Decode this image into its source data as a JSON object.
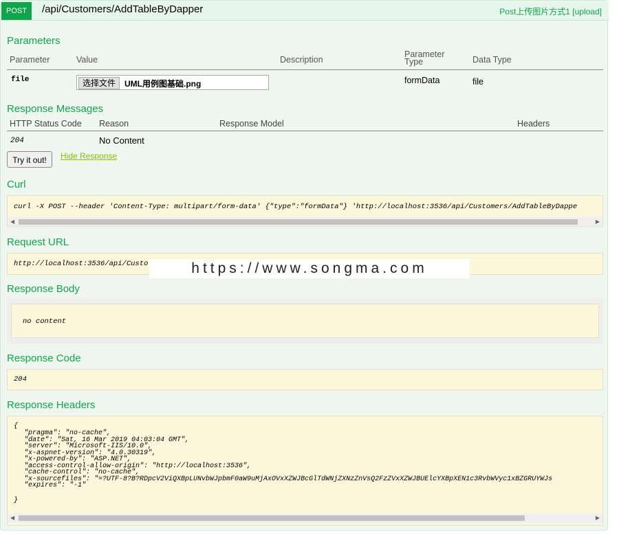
{
  "header": {
    "method": "POST",
    "path": "/api/Customers/AddTableByDapper",
    "summary": "Post上传图片方式1 [upload]"
  },
  "parameters": {
    "title": "Parameters",
    "columns": [
      "Parameter",
      "Value",
      "Description",
      "Parameter Type",
      "Data Type"
    ],
    "rows": [
      {
        "name": "file",
        "file_button": "选择文件",
        "file_name": "UML用例图基础.png",
        "description": "",
        "param_type": "formData",
        "data_type": "file"
      }
    ]
  },
  "response_messages": {
    "title": "Response Messages",
    "columns": [
      "HTTP Status Code",
      "Reason",
      "Response Model",
      "Headers"
    ],
    "rows": [
      {
        "code": "204",
        "reason": "No Content"
      }
    ]
  },
  "actions": {
    "try_label": "Try it out!",
    "hide_label": "Hide Response"
  },
  "curl": {
    "title": "Curl",
    "command": "curl -X POST --header 'Content-Type: multipart/form-data' {\"type\":\"formData\"} 'http://localhost:3536/api/Customers/AddTableByDappe"
  },
  "request_url": {
    "title": "Request URL",
    "value": "http://localhost:3536/api/Custo"
  },
  "watermark": "https://www.songma.com",
  "response_body": {
    "title": "Response Body",
    "value": "no content"
  },
  "response_code": {
    "title": "Response Code",
    "value": "204"
  },
  "response_headers": {
    "title": "Response Headers",
    "open": "{",
    "lines": [
      "\"pragma\": \"no-cache\",",
      "\"date\": \"Sat, 16 Mar 2019 04:03:04 GMT\",",
      "\"server\": \"Microsoft-IIS/10.0\",",
      "\"x-aspnet-version\": \"4.0.30319\",",
      "\"x-powered-by\": \"ASP.NET\",",
      "\"access-control-allow-origin\": \"http://localhost:3536\",",
      "\"cache-control\": \"no-cache\",",
      "\"x-sourcefiles\": \"=?UTF-8?B?RDpcV2ViQXBpLUNvbWJpbmF0aW9uMjAxOVxXZWJBcGlTdWNjZXNzZnVsQ2FzZVxXZWJBUElcYXBpXEN1c3RvbWVyc1xBZGRUYWJs",
      "\"expires\": \"-1\""
    ],
    "close": "}"
  },
  "colors": {
    "accent": "#10a54a",
    "code_bg": "#fcf6db",
    "panel_bg": "#eef6ef"
  }
}
